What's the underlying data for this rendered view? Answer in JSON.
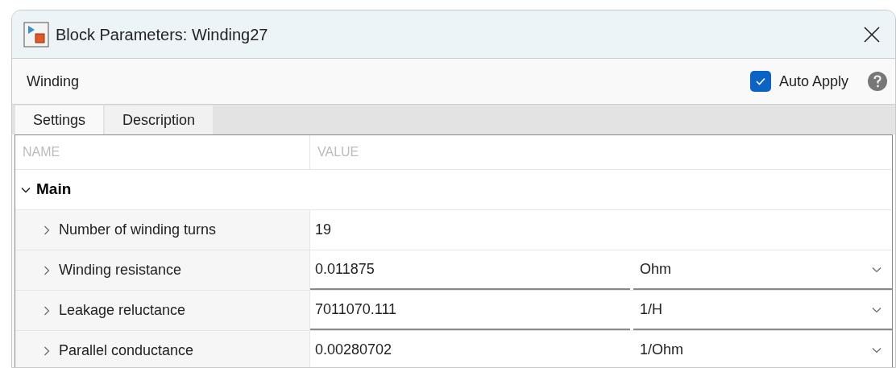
{
  "window": {
    "title": "Block Parameters: Winding27"
  },
  "toolbar": {
    "block_name": "Winding",
    "auto_apply": {
      "label": "Auto Apply",
      "checked": true
    }
  },
  "tabs": [
    {
      "label": "Settings",
      "selected": true
    },
    {
      "label": "Description",
      "selected": false
    }
  ],
  "table": {
    "columns": [
      "NAME",
      "VALUE"
    ],
    "groups": [
      {
        "label": "Main",
        "expanded": true,
        "rows": [
          {
            "name": "Number of winding turns",
            "expanded": false,
            "value": "19"
          },
          {
            "name": "Winding resistance",
            "expanded": false,
            "value": "0.011875",
            "unit": "Ohm"
          },
          {
            "name": "Leakage reluctance",
            "expanded": false,
            "value": "7011070.111",
            "unit": "1/H"
          },
          {
            "name": "Parallel conductance",
            "expanded": false,
            "value": "0.00280702",
            "unit": "1/Ohm"
          }
        ]
      }
    ]
  }
}
